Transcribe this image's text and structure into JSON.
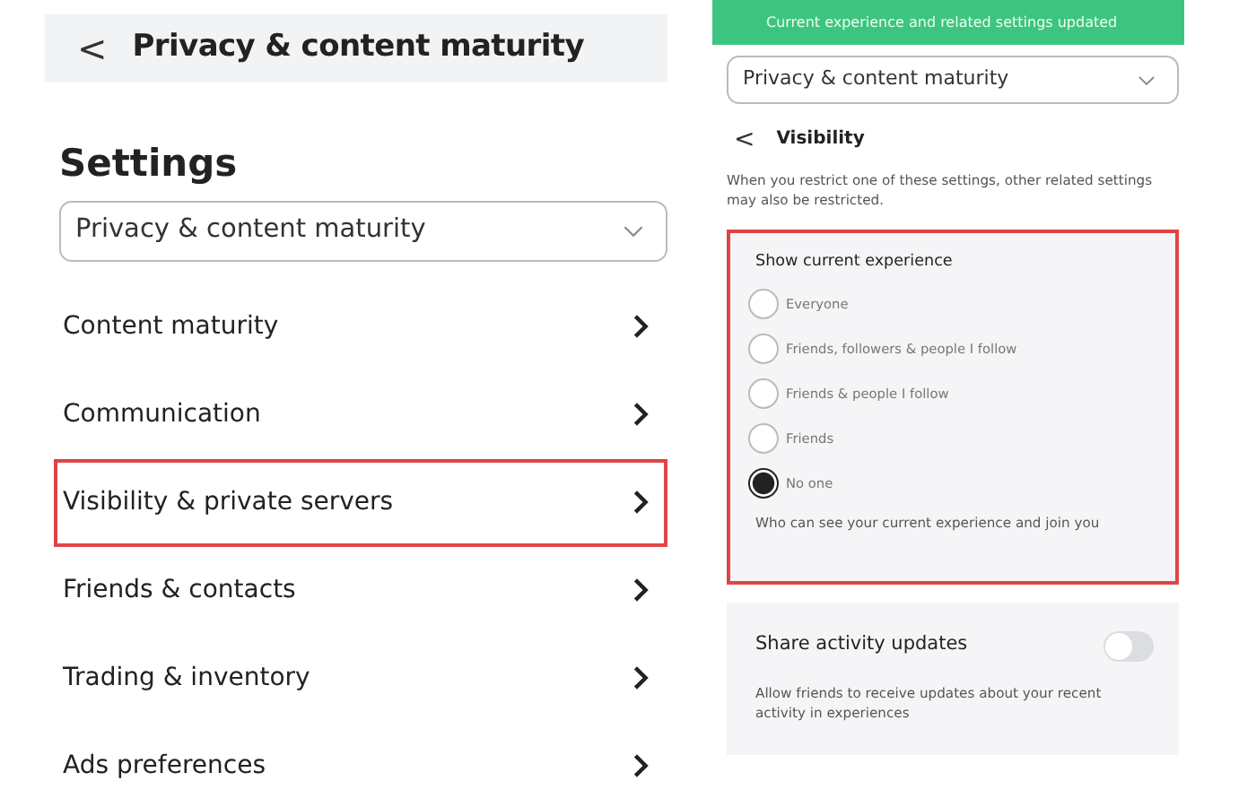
{
  "left_screen": {
    "header": {
      "back": "<",
      "title": "Privacy & content maturity"
    },
    "heading": "Settings",
    "dropdown": {
      "value": "Privacy & content maturity"
    },
    "items": [
      {
        "label": "Content maturity",
        "highlighted": false
      },
      {
        "label": "Communication",
        "highlighted": false
      },
      {
        "label": "Visibility & private servers",
        "highlighted": true
      },
      {
        "label": "Friends & contacts",
        "highlighted": false
      },
      {
        "label": "Trading & inventory",
        "highlighted": false
      },
      {
        "label": "Ads preferences",
        "highlighted": false
      }
    ]
  },
  "right_screen": {
    "toast": "Current experience and related settings updated",
    "dropdown": {
      "value": "Privacy & content maturity"
    },
    "subheader": {
      "back": "<",
      "title": "Visibility"
    },
    "description": "When you restrict one of these settings, other related settings may also be restricted.",
    "experience_card": {
      "title": "Show current experience",
      "highlighted": true,
      "options": [
        {
          "label": "Everyone",
          "selected": false
        },
        {
          "label": "Friends, followers & people I follow",
          "selected": false
        },
        {
          "label": "Friends & people I follow",
          "selected": false
        },
        {
          "label": "Friends",
          "selected": false
        },
        {
          "label": "No one",
          "selected": true
        }
      ],
      "help": "Who can see your current experience and join you"
    },
    "activity_card": {
      "title": "Share activity updates",
      "on": false,
      "help": "Allow friends to receive updates about your recent activity in experiences"
    }
  }
}
